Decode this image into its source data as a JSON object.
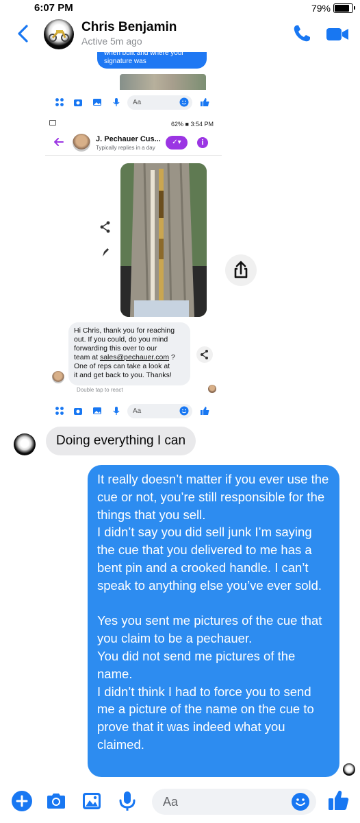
{
  "status_bar": {
    "time": "6:07 PM",
    "battery_text": "79%",
    "battery_level": 0.79
  },
  "header": {
    "contact_name": "Chris Benjamin",
    "active_status": "Active 5m ago",
    "icons": [
      "chevron-left-icon",
      "phone-icon",
      "video-camera-icon"
    ]
  },
  "embedded_screenshot": {
    "partial_bubble_text": "when built and where your signature was",
    "composer_placeholder_top": "Aa",
    "status_right": "62% ■ 3:54 PM",
    "page_name": "J. Pechauer Cus...",
    "page_subtitle": "Typically replies in a day",
    "message_lines": [
      "Hi Chris, thank you for reaching",
      "out. If you could, do you mind",
      "forwarding this over to our",
      "team at ",
      "sales@pechauer.com",
      " ?",
      "One of reps can take a look at",
      "it and get back to you. Thanks!"
    ],
    "double_tap_hint": "Double tap to react",
    "composer_placeholder_bottom": "Aa"
  },
  "messages": {
    "incoming_text": "Doing everything I can",
    "outgoing_text": "It really doesn’t matter if you ever use the cue or not, you’re still responsible for the things that you sell.\nI didn’t say you did sell junk I’m saying the cue that you delivered to me has a bent pin and a crooked handle. I can’t speak to anything else you’ve ever sold.\n\nYes you sent me pictures of the cue that you claim to be a pechauer.\nYou did not send me pictures of the name.\nI didn’t think I had to force you to send me a picture of the name on the cue to prove that it was indeed what you claimed."
  },
  "composer": {
    "placeholder": "Aa",
    "icons": [
      "plus-circle-icon",
      "camera-icon",
      "image-icon",
      "microphone-icon",
      "emoji-icon",
      "thumbs-up-icon"
    ]
  },
  "colors": {
    "accent": "#1877f2",
    "outgoing_bubble": "#2d8cf0",
    "incoming_bubble": "#e9e9eb",
    "embedded_accent": "#9b35e3"
  }
}
